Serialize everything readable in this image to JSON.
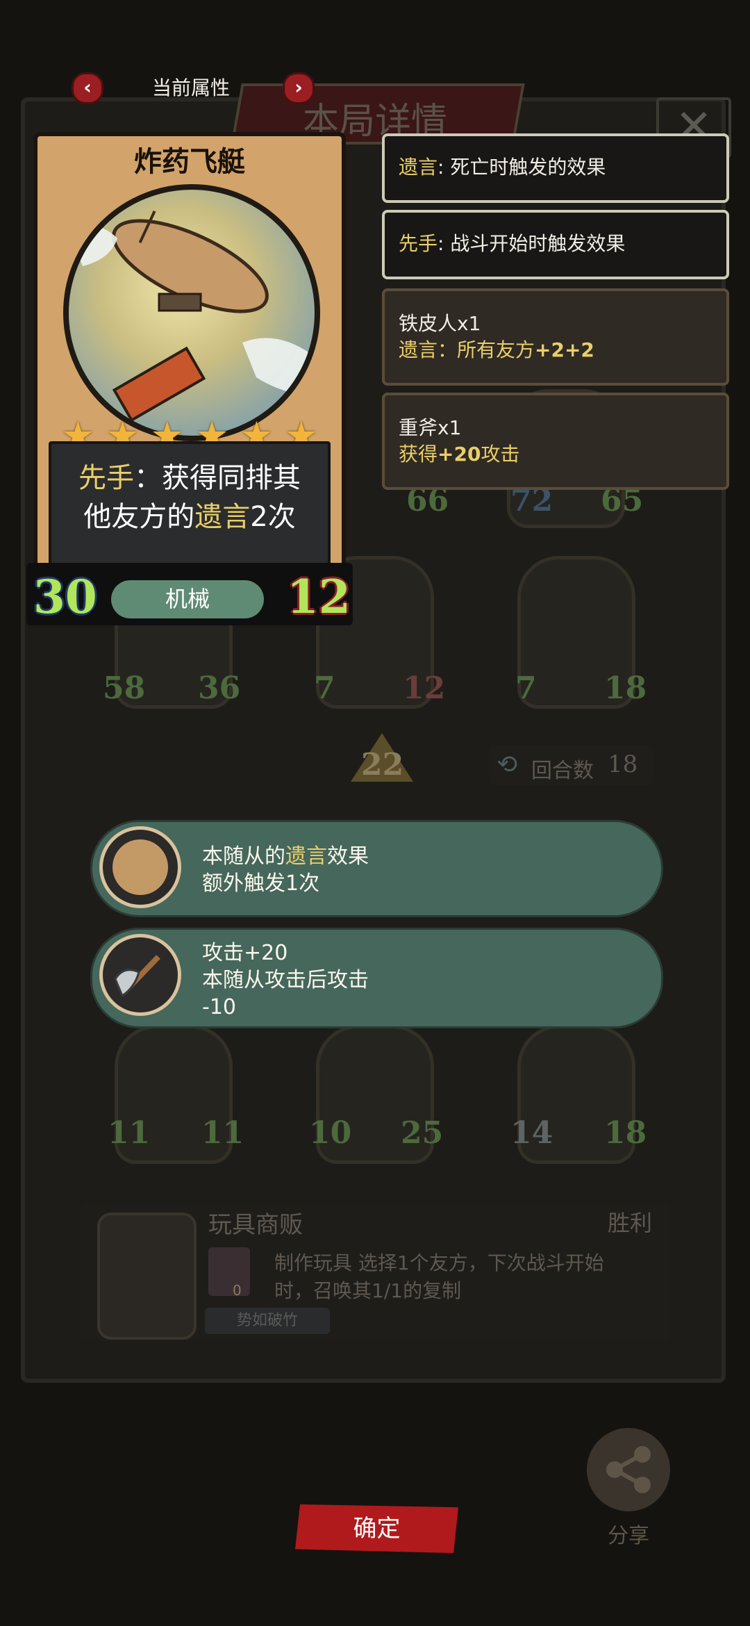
{
  "header": {
    "attr_title": "当前属性",
    "bg_title": "本局详情",
    "close_glyph": "✕"
  },
  "card": {
    "name": "炸药飞艇",
    "stars": 6,
    "text_keyword1": "先手",
    "text_part1": "：获得同排其",
    "text_part2": "他友方的",
    "text_keyword2": "遗言",
    "text_count": "2次",
    "attack": "30",
    "health": "12",
    "tribe": "机械"
  },
  "tooltips": {
    "deathrattle_keyword": "遗言",
    "deathrattle_desc": ": 死亡时触发的效果",
    "first_keyword": "先手",
    "first_desc": ": 战斗开始时触发效果",
    "item1_title": "铁皮人x1",
    "item1_line_prefix": "遗言：所有友方",
    "item1_line_bonus": "+2+2",
    "item2_title": "重斧x1",
    "item2_line_prefix": "获得",
    "item2_line_bonus": "+20",
    "item2_line_suffix": "攻击"
  },
  "bubbles": [
    {
      "line1_a": "本随从的",
      "line1_kw": "遗言",
      "line1_b": "效果",
      "line2": "额外触发1次",
      "icon": "skull-shield-icon"
    },
    {
      "line1": "攻击+20",
      "line2": "本随从攻击后攻击",
      "line3": "-10",
      "icon": "axe-icon"
    }
  ],
  "board": {
    "row1": [
      {
        "atk": "66"
      },
      {
        "atk": "72",
        "hp": "65"
      }
    ],
    "row2": [
      {
        "atk": "58",
        "hp": "36"
      },
      {
        "atk": "7",
        "hp": "12"
      },
      {
        "atk": "7",
        "hp": "18"
      }
    ],
    "row3": [
      {
        "atk": "11",
        "hp": "11"
      },
      {
        "atk": "10",
        "hp": "25"
      },
      {
        "atk": "14",
        "hp": "18"
      }
    ],
    "level": "22",
    "round_label": "回合数",
    "round_value": "18"
  },
  "opponent": {
    "name": "玩具商贩",
    "result": "胜利",
    "skill_name": "制作玩具",
    "skill_desc_1": "选择1个友方，下次战斗开始",
    "skill_desc_2": "时，召唤其1/1的复制",
    "badge": "势如破竹",
    "badge_count": "0"
  },
  "footer": {
    "confirm_label": "确定",
    "share_label": "分享"
  },
  "colors": {
    "keyword_gold": "#e9cf6a",
    "pill_green": "#46675b",
    "confirm_red": "#b11a1d",
    "stat_green": "#b2e65a"
  }
}
